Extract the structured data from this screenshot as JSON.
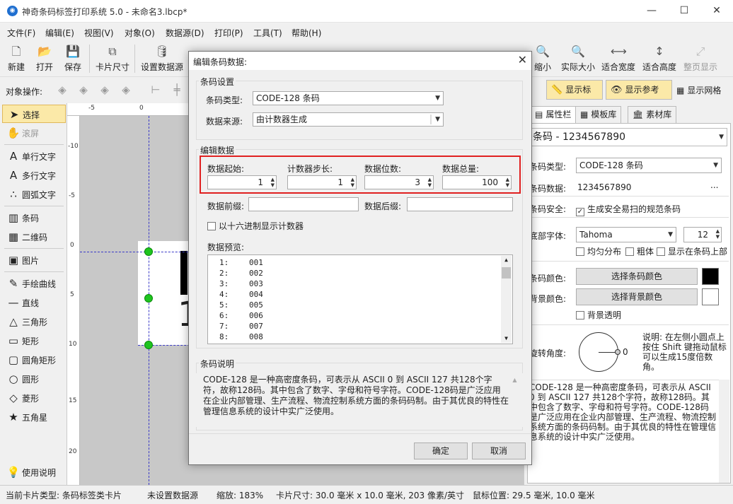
{
  "window": {
    "title": "神奇条码标签打印系统 5.0 - 未命名3.lbcp*",
    "controls": [
      "—",
      "☐",
      "✕"
    ]
  },
  "menu": [
    "文件(F)",
    "编辑(E)",
    "视图(V)",
    "对象(O)",
    "数据源(D)",
    "打印(P)",
    "工具(T)",
    "帮助(H)"
  ],
  "toolbar": {
    "new": "新建",
    "open": "打开",
    "save": "保存",
    "card_size": "卡片尺寸",
    "datasource": "设置数据源",
    "zoom_out": "缩小",
    "actual_size": "实际大小",
    "fit_width": "适合宽度",
    "fit_height": "适合高度",
    "full_page": "整页显示"
  },
  "toolbar2": {
    "object_ops": "对象操作:",
    "show_ruler": "显示标尺",
    "show_guides": "显示参考线",
    "show_grid": "显示网格"
  },
  "left_tools": [
    {
      "label": "选择",
      "icon": "➤"
    },
    {
      "label": "滚屏",
      "icon": "✋"
    },
    {
      "label": "单行文字",
      "icon": "A"
    },
    {
      "label": "多行文字",
      "icon": "A"
    },
    {
      "label": "圆弧文字",
      "icon": "∴"
    },
    {
      "label": "条码",
      "icon": "▥"
    },
    {
      "label": "二维码",
      "icon": "▦"
    },
    {
      "label": "图片",
      "icon": "▣"
    },
    {
      "label": "手绘曲线",
      "icon": "✎"
    },
    {
      "label": "直线",
      "icon": "—"
    },
    {
      "label": "三角形",
      "icon": "△"
    },
    {
      "label": "矩形",
      "icon": "▭"
    },
    {
      "label": "圆角矩形",
      "icon": "▢"
    },
    {
      "label": "圆形",
      "icon": "○"
    },
    {
      "label": "菱形",
      "icon": "◇"
    },
    {
      "label": "五角星",
      "icon": "★"
    },
    {
      "label": "使用说明",
      "icon": "💡"
    }
  ],
  "rulers": {
    "top": [
      "-5",
      "0"
    ],
    "left": [
      "-10",
      "-5",
      "0",
      "5",
      "10",
      "15",
      "20"
    ]
  },
  "right_panel": {
    "tabs": [
      "属性栏",
      "模板库",
      "素材库"
    ],
    "object_select": "条码 - 1234567890",
    "barcode_type_label": "条码类型:",
    "barcode_type": "CODE-128 条码",
    "barcode_data_label": "条码数据:",
    "barcode_data": "1234567890",
    "more_button": "...",
    "security_label": "条码安全:",
    "security_check": "生成安全易扫的规范条码",
    "font_label": "底部字体:",
    "font_name": "Tahoma",
    "font_size": "12",
    "even_dist": "均匀分布",
    "bold": "粗体",
    "show_top": "显示在条码上部",
    "barcode_color_label": "条码颜色:",
    "barcode_color_button": "选择条码颜色",
    "barcode_color": "#000000",
    "bg_color_label": "背景颜色:",
    "bg_color_button": "选择背景颜色",
    "bg_color": "#ffffff",
    "bg_transparent": "背景透明",
    "rotate_label": "旋转角度:",
    "rotate_value": "0",
    "rotate_help": "说明: 在左侧小圆点上按住 Shift 键拖动鼠标可以生成15度倍数角。",
    "description": "CODE-128 是一种高密度条码，可表示从 ASCII 0 到 ASCII 127 共128个字符，故称128码。其中包含了数字、字母和符号字符。CODE-128码是广泛应用在企业内部管理、生产流程、物流控制系统方面的条码码制。由于其优良的特性在管理信息系统的设计中实广泛使用。"
  },
  "canvas_label": {
    "barcode_text_fragment": "1"
  },
  "statusbar": {
    "card_type": "当前卡片类型:  条码标签类卡片",
    "datasource": "未设置数据源",
    "zoom": "缩放:  183%",
    "card_size": "卡片尺寸:  30.0 毫米 x 10.0 毫米, 203 像素/英寸",
    "mouse_pos": "鼠标位置:  29.5 毫米,  10.0 毫米"
  },
  "dialog": {
    "title": "编辑条码数据:",
    "close": "✕",
    "barcode_settings": "条码设置",
    "type_label": "条码类型:",
    "type_value": "CODE-128 条码",
    "source_label": "数据来源:",
    "source_value": "由计数器生成",
    "edit_data": "编辑数据",
    "start_label": "数据起始:",
    "start_value": "1",
    "step_label": "计数器步长:",
    "step_value": "1",
    "digits_label": "数据位数:",
    "digits_value": "3",
    "total_label": "数据总量:",
    "total_value": "100",
    "prefix_label": "数据前缀:",
    "suffix_label": "数据后缀:",
    "hex_check": "以十六进制显示计数器",
    "preview_label": "数据预览:",
    "preview_rows": [
      {
        "n": "1:",
        "v": "001"
      },
      {
        "n": "2:",
        "v": "002"
      },
      {
        "n": "3:",
        "v": "003"
      },
      {
        "n": "4:",
        "v": "004"
      },
      {
        "n": "5:",
        "v": "005"
      },
      {
        "n": "6:",
        "v": "006"
      },
      {
        "n": "7:",
        "v": "007"
      },
      {
        "n": "8:",
        "v": "008"
      }
    ],
    "desc_title": "条码说明",
    "desc_text": "CODE-128 是一种高密度条码，可表示从 ASCII 0 到 ASCII 127 共128个字符，故称128码。其中包含了数字、字母和符号字符。CODE-128码是广泛应用在企业内部管理、生产流程、物流控制系统方面的条码码制。由于其优良的特性在管理信息系统的设计中实广泛使用。",
    "ok": "确定",
    "cancel": "取消"
  }
}
